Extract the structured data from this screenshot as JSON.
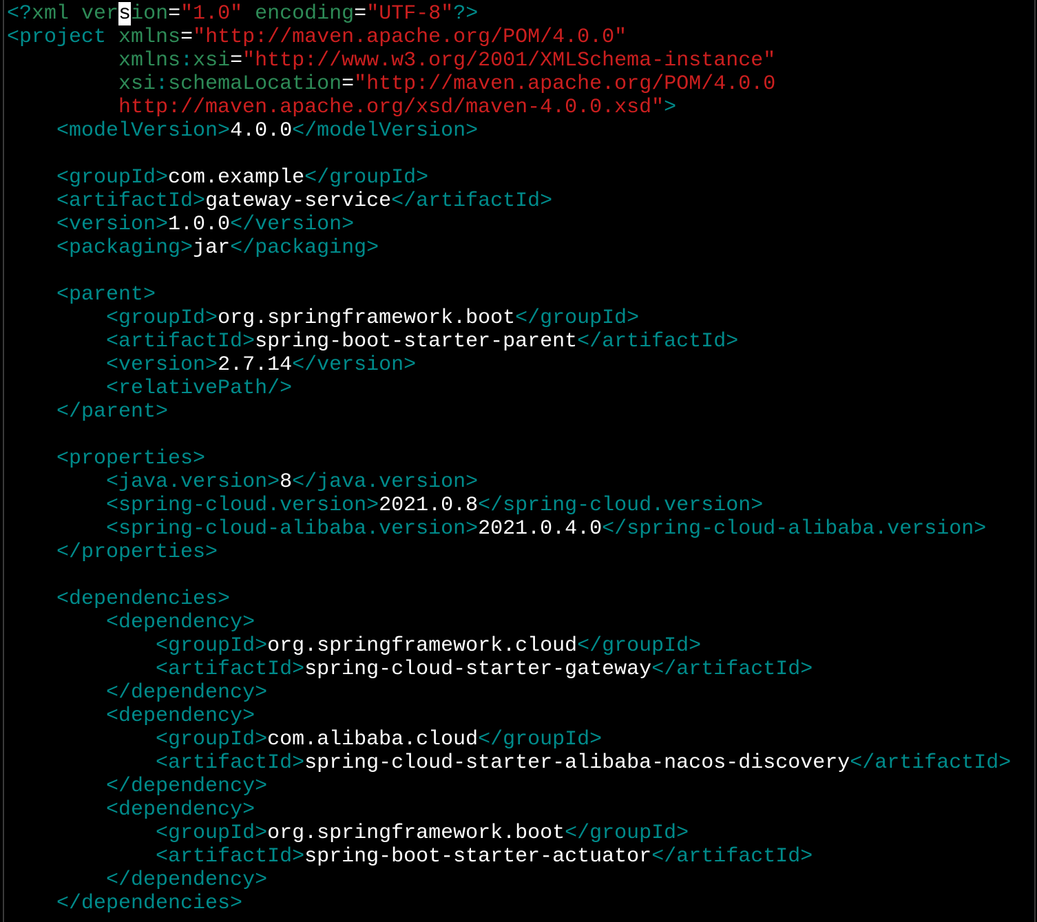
{
  "theme": {
    "background": "#000000",
    "colors": {
      "tag": "#008b8b",
      "attr": "#2e8b57",
      "str": "#cc1f1f",
      "txt": "#ffffff",
      "punc": "#008b8b",
      "eq": "#ffffff",
      "cursor": "#ffffff"
    }
  },
  "editor": {
    "lines": [
      [
        [
          "punc",
          "<?"
        ],
        [
          "attr",
          "xml"
        ],
        [
          "txt",
          " "
        ],
        [
          "attr",
          "ver"
        ],
        [
          "cursor",
          "s"
        ],
        [
          "attr",
          "ion"
        ],
        [
          "eq",
          "="
        ],
        [
          "str",
          "\"1.0\""
        ],
        [
          "txt",
          " "
        ],
        [
          "attr",
          "encoding"
        ],
        [
          "eq",
          "="
        ],
        [
          "str",
          "\"UTF-8\""
        ],
        [
          "punc",
          "?>"
        ]
      ],
      [
        [
          "tag",
          "<project"
        ],
        [
          "txt",
          " "
        ],
        [
          "attr",
          "xmlns"
        ],
        [
          "eq",
          "="
        ],
        [
          "str",
          "\"http://maven.apache.org/POM/4.0.0\""
        ]
      ],
      [
        [
          "txt",
          "         "
        ],
        [
          "attr",
          "xmlns"
        ],
        [
          "punc",
          ":"
        ],
        [
          "attr",
          "xsi"
        ],
        [
          "eq",
          "="
        ],
        [
          "str",
          "\"http://www.w3.org/2001/XMLSchema-instance\""
        ]
      ],
      [
        [
          "txt",
          "         "
        ],
        [
          "attr",
          "xsi"
        ],
        [
          "punc",
          ":"
        ],
        [
          "attr",
          "schemaLocation"
        ],
        [
          "eq",
          "="
        ],
        [
          "str",
          "\"http://maven.apache.org/POM/4.0.0"
        ]
      ],
      [
        [
          "txt",
          "         "
        ],
        [
          "str",
          "http://maven.apache.org/xsd/maven-4.0.0.xsd\""
        ],
        [
          "punc",
          ">"
        ]
      ],
      [
        [
          "txt",
          "    "
        ],
        [
          "tag",
          "<modelVersion>"
        ],
        [
          "txt",
          "4.0.0"
        ],
        [
          "tag",
          "</modelVersion>"
        ]
      ],
      [],
      [
        [
          "txt",
          "    "
        ],
        [
          "tag",
          "<groupId>"
        ],
        [
          "txt",
          "com.example"
        ],
        [
          "tag",
          "</groupId>"
        ]
      ],
      [
        [
          "txt",
          "    "
        ],
        [
          "tag",
          "<artifactId>"
        ],
        [
          "txt",
          "gateway-service"
        ],
        [
          "tag",
          "</artifactId>"
        ]
      ],
      [
        [
          "txt",
          "    "
        ],
        [
          "tag",
          "<version>"
        ],
        [
          "txt",
          "1.0.0"
        ],
        [
          "tag",
          "</version>"
        ]
      ],
      [
        [
          "txt",
          "    "
        ],
        [
          "tag",
          "<packaging>"
        ],
        [
          "txt",
          "jar"
        ],
        [
          "tag",
          "</packaging>"
        ]
      ],
      [],
      [
        [
          "txt",
          "    "
        ],
        [
          "tag",
          "<parent>"
        ]
      ],
      [
        [
          "txt",
          "        "
        ],
        [
          "tag",
          "<groupId>"
        ],
        [
          "txt",
          "org.springframework.boot"
        ],
        [
          "tag",
          "</groupId>"
        ]
      ],
      [
        [
          "txt",
          "        "
        ],
        [
          "tag",
          "<artifactId>"
        ],
        [
          "txt",
          "spring-boot-starter-parent"
        ],
        [
          "tag",
          "</artifactId>"
        ]
      ],
      [
        [
          "txt",
          "        "
        ],
        [
          "tag",
          "<version>"
        ],
        [
          "txt",
          "2.7.14"
        ],
        [
          "tag",
          "</version>"
        ]
      ],
      [
        [
          "txt",
          "        "
        ],
        [
          "tag",
          "<relativePath/>"
        ]
      ],
      [
        [
          "txt",
          "    "
        ],
        [
          "tag",
          "</parent>"
        ]
      ],
      [],
      [
        [
          "txt",
          "    "
        ],
        [
          "tag",
          "<properties>"
        ]
      ],
      [
        [
          "txt",
          "        "
        ],
        [
          "tag",
          "<java.version>"
        ],
        [
          "txt",
          "8"
        ],
        [
          "tag",
          "</java.version>"
        ]
      ],
      [
        [
          "txt",
          "        "
        ],
        [
          "tag",
          "<spring-cloud.version>"
        ],
        [
          "txt",
          "2021.0.8"
        ],
        [
          "tag",
          "</spring-cloud.version>"
        ]
      ],
      [
        [
          "txt",
          "        "
        ],
        [
          "tag",
          "<spring-cloud-alibaba.version>"
        ],
        [
          "txt",
          "2021.0.4.0"
        ],
        [
          "tag",
          "</spring-cloud-alibaba.version>"
        ]
      ],
      [
        [
          "txt",
          "    "
        ],
        [
          "tag",
          "</properties>"
        ]
      ],
      [],
      [
        [
          "txt",
          "    "
        ],
        [
          "tag",
          "<dependencies>"
        ]
      ],
      [
        [
          "txt",
          "        "
        ],
        [
          "tag",
          "<dependency>"
        ]
      ],
      [
        [
          "txt",
          "            "
        ],
        [
          "tag",
          "<groupId>"
        ],
        [
          "txt",
          "org.springframework.cloud"
        ],
        [
          "tag",
          "</groupId>"
        ]
      ],
      [
        [
          "txt",
          "            "
        ],
        [
          "tag",
          "<artifactId>"
        ],
        [
          "txt",
          "spring-cloud-starter-gateway"
        ],
        [
          "tag",
          "</artifactId>"
        ]
      ],
      [
        [
          "txt",
          "        "
        ],
        [
          "tag",
          "</dependency>"
        ]
      ],
      [
        [
          "txt",
          "        "
        ],
        [
          "tag",
          "<dependency>"
        ]
      ],
      [
        [
          "txt",
          "            "
        ],
        [
          "tag",
          "<groupId>"
        ],
        [
          "txt",
          "com.alibaba.cloud"
        ],
        [
          "tag",
          "</groupId>"
        ]
      ],
      [
        [
          "txt",
          "            "
        ],
        [
          "tag",
          "<artifactId>"
        ],
        [
          "txt",
          "spring-cloud-starter-alibaba-nacos-discovery"
        ],
        [
          "tag",
          "</artifactId>"
        ]
      ],
      [
        [
          "txt",
          "        "
        ],
        [
          "tag",
          "</dependency>"
        ]
      ],
      [
        [
          "txt",
          "        "
        ],
        [
          "tag",
          "<dependency>"
        ]
      ],
      [
        [
          "txt",
          "            "
        ],
        [
          "tag",
          "<groupId>"
        ],
        [
          "txt",
          "org.springframework.boot"
        ],
        [
          "tag",
          "</groupId>"
        ]
      ],
      [
        [
          "txt",
          "            "
        ],
        [
          "tag",
          "<artifactId>"
        ],
        [
          "txt",
          "spring-boot-starter-actuator"
        ],
        [
          "tag",
          "</artifactId>"
        ]
      ],
      [
        [
          "txt",
          "        "
        ],
        [
          "tag",
          "</dependency>"
        ]
      ],
      [
        [
          "txt",
          "    "
        ],
        [
          "tag",
          "</dependencies>"
        ]
      ]
    ]
  }
}
